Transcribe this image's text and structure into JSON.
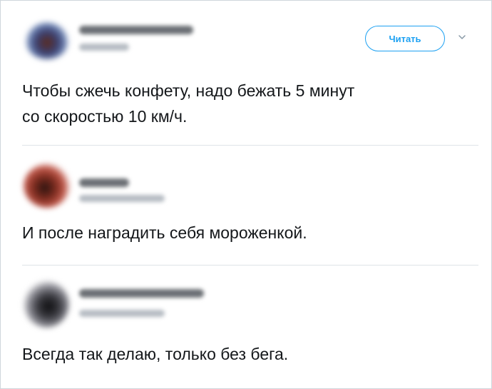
{
  "tweets": [
    {
      "text": "Чтобы сжечь конфету, надо бежать 5 минут\nсо скоростью 10 км/ч.",
      "follow_label": "Читать"
    },
    {
      "text": "И после наградить себя мороженкой."
    },
    {
      "text": "Всегда так делаю, только без бега."
    }
  ],
  "icons": {
    "more": "chevron-down-icon"
  },
  "colors": {
    "accent": "#1da1f2",
    "text": "#14171a",
    "divider": "#dfe4e8"
  }
}
